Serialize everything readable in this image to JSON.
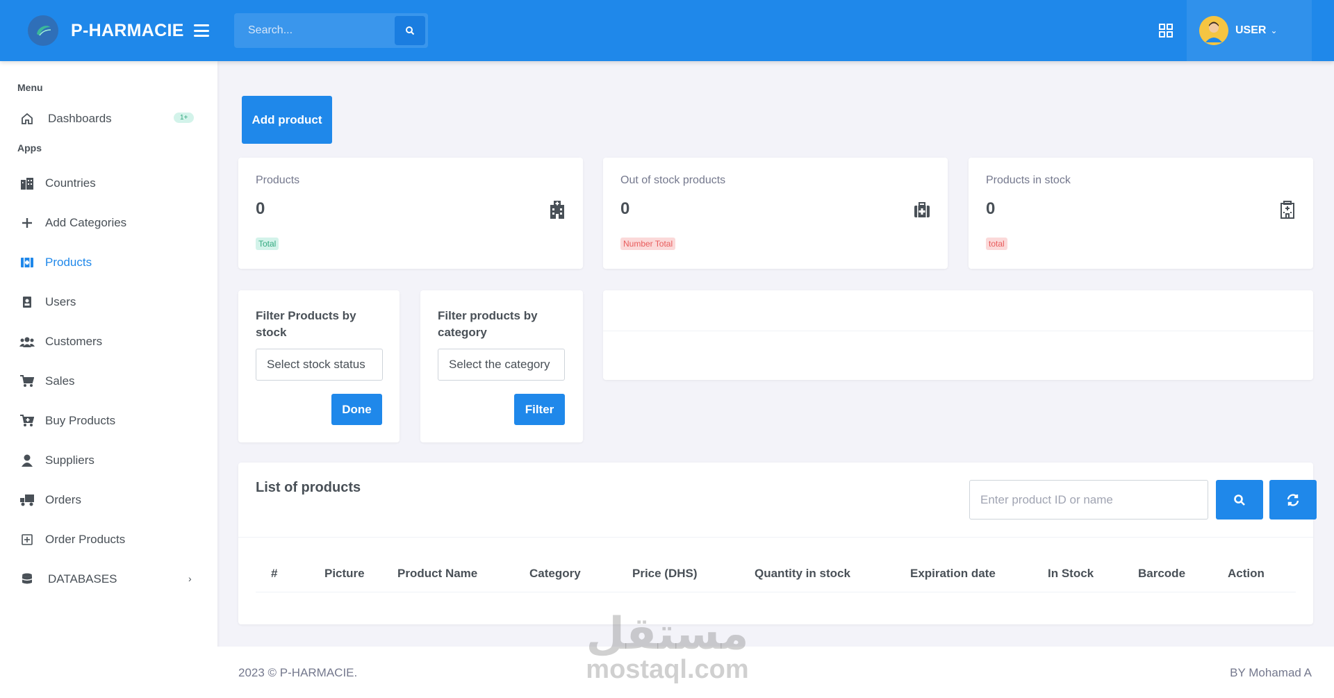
{
  "header": {
    "brand": "P-HARMACIE",
    "search_placeholder": "Search...",
    "user": "USER"
  },
  "sidebar": {
    "menu_title": "Menu",
    "dashboards": "Dashboards",
    "dashboards_badge": "1+",
    "apps_title": "Apps",
    "items": [
      {
        "label": "Countries",
        "icon": "buildings-icon"
      },
      {
        "label": "Add Categories",
        "icon": "plus-icon"
      },
      {
        "label": "Products",
        "icon": "products-icon",
        "active": true
      },
      {
        "label": "Users",
        "icon": "id-badge-icon"
      },
      {
        "label": "Customers",
        "icon": "users-group-icon"
      },
      {
        "label": "Sales",
        "icon": "cart-icon"
      },
      {
        "label": "Buy Products",
        "icon": "cart-plus-icon"
      },
      {
        "label": "Suppliers",
        "icon": "user-icon"
      },
      {
        "label": "Orders",
        "icon": "truck-icon"
      },
      {
        "label": "Order Products",
        "icon": "plus-square-icon"
      }
    ],
    "databases": "DATABASES"
  },
  "main": {
    "add_product": "Add product",
    "stats": [
      {
        "title": "Products",
        "value": "0",
        "badge": "Total",
        "icon": "hospital-icon"
      },
      {
        "title": "Out of stock products",
        "value": "0",
        "badge": "Number Total",
        "icon": "medical-kit-icon"
      },
      {
        "title": "Products in stock",
        "value": "0",
        "badge": "total",
        "icon": "clinic-icon"
      }
    ],
    "filter_stock": {
      "title": "Filter Products by stock",
      "select": "Select stock status",
      "button": "Done"
    },
    "filter_category": {
      "title": "Filter products by category",
      "select": "Select the category",
      "button": "Filter"
    },
    "list": {
      "title": "List of products",
      "search_placeholder": "Enter product ID or name",
      "columns": [
        "#",
        "Picture",
        "Product Name",
        "Category",
        "Price (DHS)",
        "Quantity in stock",
        "Expiration date",
        "In Stock",
        "Barcode",
        "Action"
      ]
    }
  },
  "footer": {
    "left": "2023 © P-HARMACIE.",
    "right": "BY Mohamad A"
  },
  "watermark": {
    "arabic": "مستقل",
    "latin": "mostaql.com"
  },
  "colors": {
    "primary": "#1f88ea",
    "background": "#f3f3f9",
    "success_soft": "#d3f3ea",
    "danger_soft": "#fbd9d9"
  }
}
